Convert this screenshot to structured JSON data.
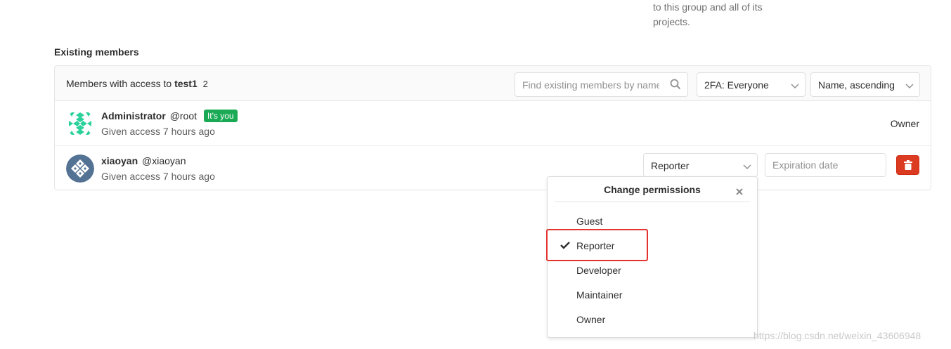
{
  "top_note": {
    "line1": "to this group and all of its",
    "line2": "projects."
  },
  "section_title": "Existing members",
  "header": {
    "prefix": "Members with access to",
    "group": "test1",
    "count": "2",
    "search_placeholder": "Find existing members by name",
    "filter_2fa": "2FA: Everyone",
    "sort": "Name, ascending"
  },
  "members": [
    {
      "name": "Administrator",
      "username": "@root",
      "badge": "It's you",
      "given": "Given access 7 hours ago",
      "role": "Owner"
    },
    {
      "name": "xiaoyan",
      "username": "@xiaoyan",
      "given": "Given access 7 hours ago",
      "role": "Reporter",
      "expiration_placeholder": "Expiration date"
    }
  ],
  "permissions_popup": {
    "title": "Change permissions",
    "options": [
      "Guest",
      "Reporter",
      "Developer",
      "Maintainer",
      "Owner"
    ],
    "selected": "Reporter"
  },
  "watermark": "https://blog.csdn.net/weixin_43606948",
  "colors": {
    "badge_green": "#1aaa55",
    "delete_red": "#db3b21",
    "highlight_red": "#e3342f"
  }
}
